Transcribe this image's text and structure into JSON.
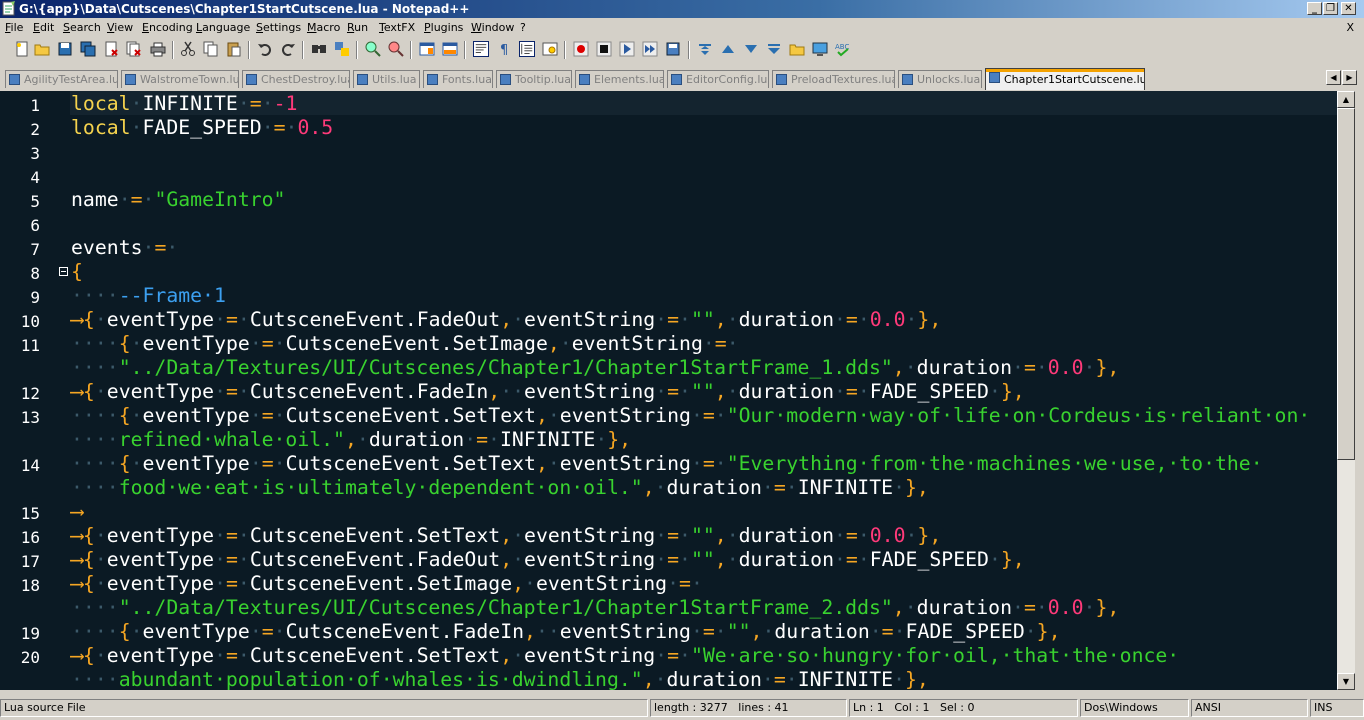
{
  "window": {
    "title": "G:\\{app}\\Data\\Cutscenes\\Chapter1StartCutscene.lua - Notepad++",
    "controls": {
      "minimize": "_",
      "restore": "❐",
      "close": "✕"
    }
  },
  "menu": {
    "items": [
      "File",
      "Edit",
      "Search",
      "View",
      "Encoding",
      "Language",
      "Settings",
      "Macro",
      "Run",
      "TextFX",
      "Plugins",
      "Window",
      "?"
    ],
    "close": "X"
  },
  "toolbar": {
    "icons": [
      "new-file-icon",
      "open-file-icon",
      "save-icon",
      "save-all-icon",
      "close-icon",
      "close-all-icon",
      "print-icon",
      "cut-icon",
      "copy-icon",
      "paste-icon",
      "undo-icon",
      "redo-icon",
      "find-icon",
      "replace-icon",
      "zoom-in-icon",
      "zoom-out-icon",
      "sync-vertical-icon",
      "sync-horizontal-icon",
      "word-wrap-icon",
      "show-all-chars-icon",
      "indent-guide-icon",
      "user-lang-icon",
      "record-macro-icon",
      "stop-macro-icon",
      "play-macro-icon",
      "run-macro-multiple-icon",
      "save-macro-icon",
      "trim-icon",
      "up-icon",
      "down-icon",
      "run-icon",
      "folder-icon",
      "monitor-icon",
      "spellcheck-icon"
    ]
  },
  "tabs": [
    {
      "label": "AgilityTestArea.lua",
      "active": false
    },
    {
      "label": "WalstromeTown.lua",
      "active": false
    },
    {
      "label": "ChestDestroy.lua",
      "active": false
    },
    {
      "label": "Utils.lua",
      "active": false
    },
    {
      "label": "Fonts.lua",
      "active": false
    },
    {
      "label": "Tooltip.lua",
      "active": false
    },
    {
      "label": "Elements.lua",
      "active": false
    },
    {
      "label": "EditorConfig.lua",
      "active": false
    },
    {
      "label": "PreloadTextures.lua",
      "active": false
    },
    {
      "label": "Unlocks.lua",
      "active": false
    },
    {
      "label": "Chapter1StartCutscene.lua",
      "active": true
    }
  ],
  "editor": {
    "line_numbers": [
      "1",
      "2",
      "3",
      "4",
      "5",
      "6",
      "7",
      "8",
      "9",
      "10",
      "11",
      "12",
      "13",
      "14",
      "15",
      "16",
      "17",
      "18",
      "19",
      "20"
    ],
    "colors": {
      "background": "#0b1a24",
      "keyword": "#f5d34e",
      "operator": "#f5a623",
      "number": "#ff3a7a",
      "string": "#39d22f",
      "comment": "#3ca0f0"
    },
    "lines": [
      [
        [
          "kw",
          "local"
        ],
        [
          "",
          "·INFINITE·"
        ],
        [
          "op",
          "="
        ],
        [
          "",
          "·"
        ],
        [
          "num",
          "-1"
        ]
      ],
      [
        [
          "kw",
          "local"
        ],
        [
          "",
          "·FADE_SPEED·"
        ],
        [
          "op",
          "="
        ],
        [
          "",
          "·"
        ],
        [
          "num",
          "0.5"
        ]
      ],
      [],
      [],
      [
        [
          "",
          "name·"
        ],
        [
          "op",
          "="
        ],
        [
          "",
          "·"
        ],
        [
          "str",
          "\"GameIntro\""
        ]
      ],
      [],
      [
        [
          "",
          "events·"
        ],
        [
          "op",
          "="
        ],
        [
          "",
          "·"
        ]
      ],
      [
        [
          "op",
          "{"
        ]
      ],
      [
        [
          "",
          "····"
        ],
        [
          "cmt",
          "--Frame·1"
        ]
      ],
      [
        [
          "indent",
          "⟶"
        ],
        [
          "op",
          "{"
        ],
        [
          "",
          "·eventType·"
        ],
        [
          "op",
          "="
        ],
        [
          "",
          "·CutsceneEvent.FadeOut"
        ],
        [
          "op",
          ","
        ],
        [
          "",
          "·eventString·"
        ],
        [
          "op",
          "="
        ],
        [
          "",
          "·"
        ],
        [
          "str",
          "\"\""
        ],
        [
          "op",
          ","
        ],
        [
          "",
          "·duration·"
        ],
        [
          "op",
          "="
        ],
        [
          "",
          "·"
        ],
        [
          "num",
          "0.0"
        ],
        [
          "",
          "·"
        ],
        [
          "op",
          "},"
        ]
      ],
      [
        [
          "",
          "····"
        ],
        [
          "op",
          "{"
        ],
        [
          "",
          "·eventType·"
        ],
        [
          "op",
          "="
        ],
        [
          "",
          "·CutsceneEvent.SetImage"
        ],
        [
          "op",
          ","
        ],
        [
          "",
          "·eventString·"
        ],
        [
          "op",
          "="
        ],
        [
          "",
          "·"
        ]
      ],
      [
        [
          "",
          "····"
        ],
        [
          "str",
          "\"../Data/Textures/UI/Cutscenes/Chapter1/Chapter1StartFrame_1.dds\""
        ],
        [
          "op",
          ","
        ],
        [
          "",
          "·duration·"
        ],
        [
          "op",
          "="
        ],
        [
          "",
          "·"
        ],
        [
          "num",
          "0.0"
        ],
        [
          "",
          "·"
        ],
        [
          "op",
          "},"
        ]
      ],
      [
        [
          "indent",
          "⟶"
        ],
        [
          "op",
          "{"
        ],
        [
          "",
          "·eventType·"
        ],
        [
          "op",
          "="
        ],
        [
          "",
          "·CutsceneEvent.FadeIn"
        ],
        [
          "op",
          ","
        ],
        [
          "",
          "··eventString·"
        ],
        [
          "op",
          "="
        ],
        [
          "",
          "·"
        ],
        [
          "str",
          "\"\""
        ],
        [
          "op",
          ","
        ],
        [
          "",
          "·duration·"
        ],
        [
          "op",
          "="
        ],
        [
          "",
          "·FADE_SPEED·"
        ],
        [
          "op",
          "},"
        ]
      ],
      [
        [
          "",
          "····"
        ],
        [
          "op",
          "{"
        ],
        [
          "",
          "·eventType·"
        ],
        [
          "op",
          "="
        ],
        [
          "",
          "·CutsceneEvent.SetText"
        ],
        [
          "op",
          ","
        ],
        [
          "",
          "·eventString·"
        ],
        [
          "op",
          "="
        ],
        [
          "",
          "·"
        ],
        [
          "str",
          "\"Our·modern·way·of·life·on·Cordeus·is·reliant·on·"
        ]
      ],
      [
        [
          "",
          "····"
        ],
        [
          "str",
          "refined·whale·oil.\""
        ],
        [
          "op",
          ","
        ],
        [
          "",
          "·duration·"
        ],
        [
          "op",
          "="
        ],
        [
          "",
          "·INFINITE·"
        ],
        [
          "op",
          "},"
        ]
      ],
      [
        [
          "",
          "····"
        ],
        [
          "op",
          "{"
        ],
        [
          "",
          "·eventType·"
        ],
        [
          "op",
          "="
        ],
        [
          "",
          "·CutsceneEvent.SetText"
        ],
        [
          "op",
          ","
        ],
        [
          "",
          "·eventString·"
        ],
        [
          "op",
          "="
        ],
        [
          "",
          "·"
        ],
        [
          "str",
          "\"Everything·from·the·machines·we·use,·to·the·"
        ]
      ],
      [
        [
          "",
          "····"
        ],
        [
          "str",
          "food·we·eat·is·ultimately·dependent·on·oil.\""
        ],
        [
          "op",
          ","
        ],
        [
          "",
          "·duration·"
        ],
        [
          "op",
          "="
        ],
        [
          "",
          "·INFINITE·"
        ],
        [
          "op",
          "},"
        ]
      ],
      [
        [
          "indent",
          "⟶"
        ]
      ],
      [
        [
          "indent",
          "⟶"
        ],
        [
          "op",
          "{"
        ],
        [
          "",
          "·eventType·"
        ],
        [
          "op",
          "="
        ],
        [
          "",
          "·CutsceneEvent.SetText"
        ],
        [
          "op",
          ","
        ],
        [
          "",
          "·eventString·"
        ],
        [
          "op",
          "="
        ],
        [
          "",
          "·"
        ],
        [
          "str",
          "\"\""
        ],
        [
          "op",
          ","
        ],
        [
          "",
          "·duration·"
        ],
        [
          "op",
          "="
        ],
        [
          "",
          "·"
        ],
        [
          "num",
          "0.0"
        ],
        [
          "",
          "·"
        ],
        [
          "op",
          "},"
        ]
      ],
      [
        [
          "indent",
          "⟶"
        ],
        [
          "op",
          "{"
        ],
        [
          "",
          "·eventType·"
        ],
        [
          "op",
          "="
        ],
        [
          "",
          "·CutsceneEvent.FadeOut"
        ],
        [
          "op",
          ","
        ],
        [
          "",
          "·eventString·"
        ],
        [
          "op",
          "="
        ],
        [
          "",
          "·"
        ],
        [
          "str",
          "\"\""
        ],
        [
          "op",
          ","
        ],
        [
          "",
          "·duration·"
        ],
        [
          "op",
          "="
        ],
        [
          "",
          "·FADE_SPEED·"
        ],
        [
          "op",
          "},"
        ]
      ],
      [
        [
          "indent",
          "⟶"
        ],
        [
          "op",
          "{"
        ],
        [
          "",
          "·eventType·"
        ],
        [
          "op",
          "="
        ],
        [
          "",
          "·CutsceneEvent.SetImage"
        ],
        [
          "op",
          ","
        ],
        [
          "",
          "·eventString·"
        ],
        [
          "op",
          "="
        ],
        [
          "",
          "·"
        ]
      ],
      [
        [
          "",
          "····"
        ],
        [
          "str",
          "\"../Data/Textures/UI/Cutscenes/Chapter1/Chapter1StartFrame_2.dds\""
        ],
        [
          "op",
          ","
        ],
        [
          "",
          "·duration·"
        ],
        [
          "op",
          "="
        ],
        [
          "",
          "·"
        ],
        [
          "num",
          "0.0"
        ],
        [
          "",
          "·"
        ],
        [
          "op",
          "},"
        ]
      ],
      [
        [
          "",
          "····"
        ],
        [
          "op",
          "{"
        ],
        [
          "",
          "·eventType·"
        ],
        [
          "op",
          "="
        ],
        [
          "",
          "·CutsceneEvent.FadeIn"
        ],
        [
          "op",
          ","
        ],
        [
          "",
          "··eventString·"
        ],
        [
          "op",
          "="
        ],
        [
          "",
          "·"
        ],
        [
          "str",
          "\"\""
        ],
        [
          "op",
          ","
        ],
        [
          "",
          "·duration·"
        ],
        [
          "op",
          "="
        ],
        [
          "",
          "·FADE_SPEED·"
        ],
        [
          "op",
          "},"
        ]
      ],
      [
        [
          "indent",
          "⟶"
        ],
        [
          "op",
          "{"
        ],
        [
          "",
          "·eventType·"
        ],
        [
          "op",
          "="
        ],
        [
          "",
          "·CutsceneEvent.SetText"
        ],
        [
          "op",
          ","
        ],
        [
          "",
          "·eventString·"
        ],
        [
          "op",
          "="
        ],
        [
          "",
          "·"
        ],
        [
          "str",
          "\"We·are·so·hungry·for·oil,·that·the·once·"
        ]
      ],
      [
        [
          "",
          "····"
        ],
        [
          "str",
          "abundant·population·of·whales·is·dwindling.\""
        ],
        [
          "op",
          ","
        ],
        [
          "",
          "·duration·"
        ],
        [
          "op",
          "="
        ],
        [
          "",
          "·INFINITE·"
        ],
        [
          "op",
          "},"
        ]
      ]
    ],
    "line_number_rows": [
      0,
      1,
      2,
      3,
      4,
      5,
      6,
      7,
      8,
      9,
      10,
      12,
      13,
      15,
      17,
      18,
      19,
      20,
      22,
      23
    ]
  },
  "statusbar": {
    "filetype": "Lua source File",
    "length": "length : 3277",
    "lines": "lines : 41",
    "ln": "Ln : 1",
    "col": "Col : 1",
    "sel": "Sel : 0",
    "eol": "Dos\\Windows",
    "encoding": "ANSI",
    "mode": "INS"
  }
}
